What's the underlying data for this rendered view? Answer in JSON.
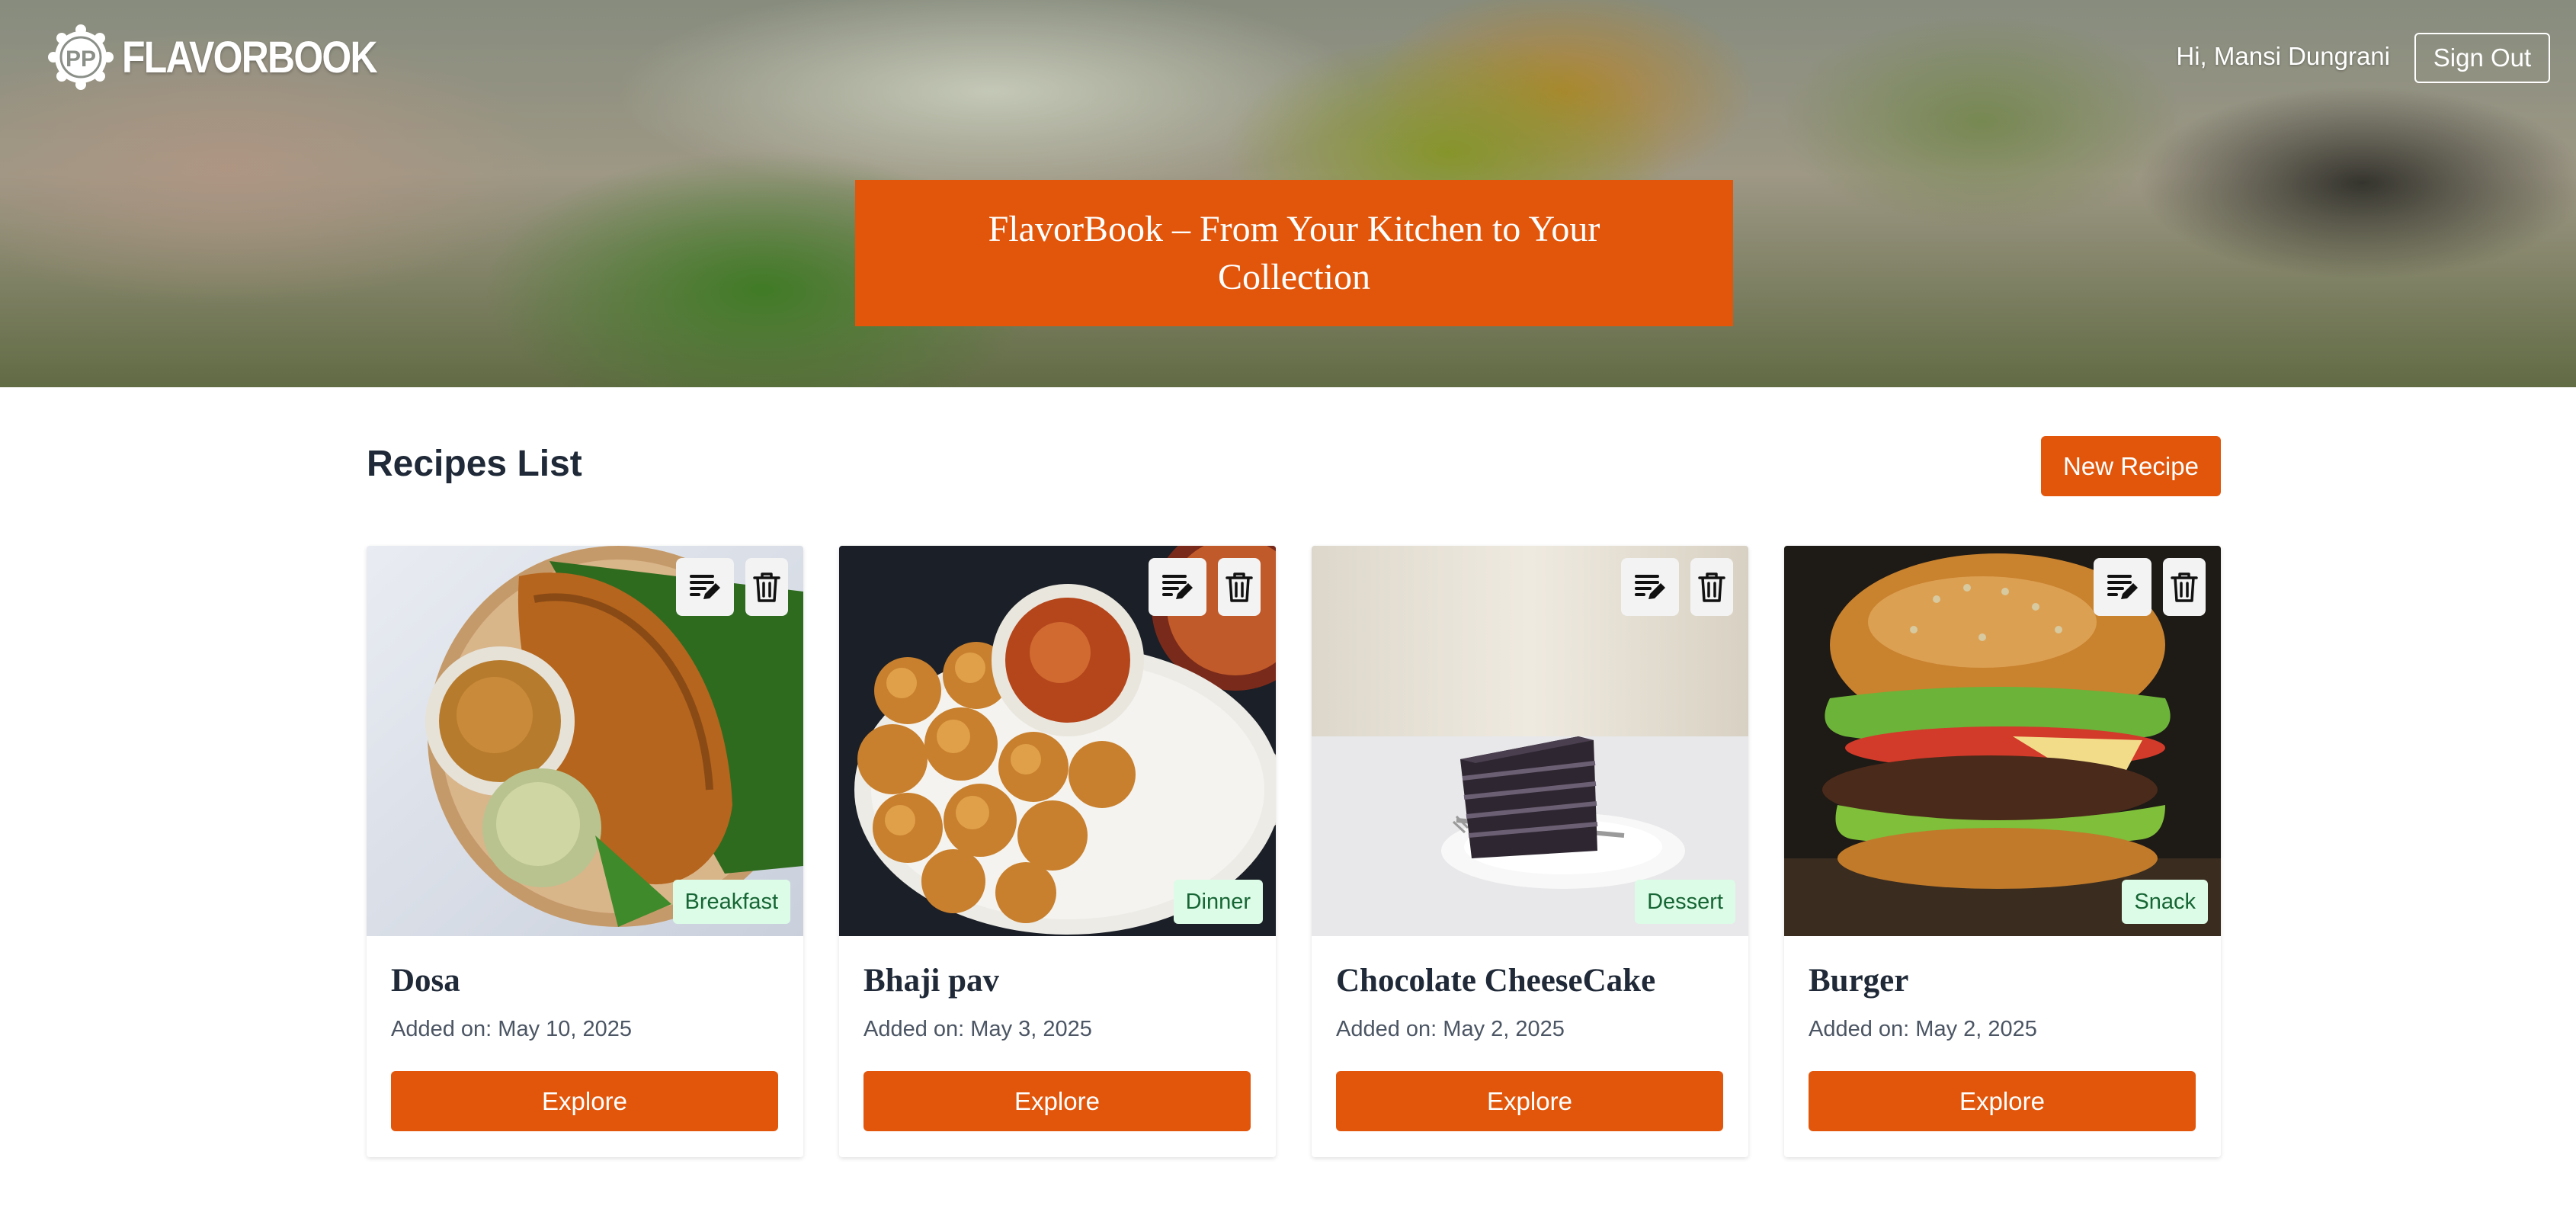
{
  "header": {
    "brand": "FLAVORBOOK",
    "greeting": "Hi, Mansi Dungrani",
    "sign_out_label": "Sign Out",
    "hero_title": "FlavorBook – From Your Kitchen to Your Collection"
  },
  "main": {
    "section_title": "Recipes List",
    "new_recipe_label": "New Recipe",
    "explore_label": "Explore",
    "recipes": [
      {
        "name": "Dosa",
        "date": "Added on: May 10, 2025",
        "category": "Breakfast"
      },
      {
        "name": "Bhaji pav",
        "date": "Added on: May 3, 2025",
        "category": "Dinner"
      },
      {
        "name": "Chocolate CheeseCake",
        "date": "Added on: May 2, 2025",
        "category": "Dessert"
      },
      {
        "name": "Burger",
        "date": "Added on: May 2, 2025",
        "category": "Snack"
      }
    ]
  },
  "icons": {
    "edit": "edit-note-icon",
    "delete": "trash-icon",
    "logo": "chef-hat-logo-icon"
  },
  "colors": {
    "accent": "#e2560b",
    "badge_bg": "#dcfce7",
    "badge_text": "#166534",
    "text": "#1f2937"
  }
}
